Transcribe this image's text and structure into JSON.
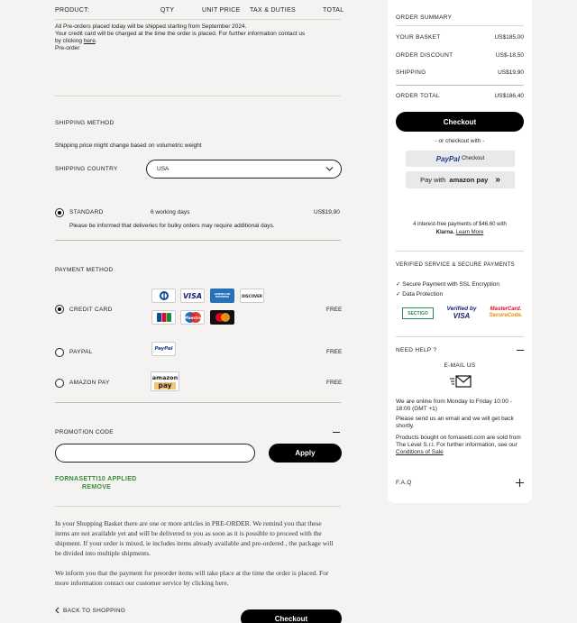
{
  "table_header": {
    "product": "PRODUCT:",
    "qty": "QTY",
    "unit_price": "UNIT PRICE",
    "tax": "TAX & DUTIES",
    "total": "TOTAL"
  },
  "preorder": {
    "line1": "All Pre-orders placed today will be shipped starting from September 2024.",
    "line2": "Your credit card will be charged at the time the order is placed. For further information contact us",
    "line3_prefix": "by clicking ",
    "line3_link": "here",
    "line3_suffix": ".",
    "label": "Pre-order"
  },
  "shipping": {
    "title": "SHIPPING METHOD",
    "note": "Shipping price might change based on volumetric weight",
    "country_label": "SHIPPING COUNTRY",
    "country_value": "USA",
    "option_label": "STANDARD",
    "option_days": "6 working days",
    "option_price": "US$19,90",
    "bulky_note": "Please be informed that deliveries for bulky orders may require additional days."
  },
  "payment": {
    "title": "PAYMENT METHOD",
    "methods": [
      {
        "label": "CREDIT CARD",
        "fee": "FREE"
      },
      {
        "label": "PAYPAL",
        "fee": "FREE"
      },
      {
        "label": "AMAZON PAY",
        "fee": "FREE"
      }
    ],
    "cards": [
      "VISA",
      "AMERICAN EXPRESS",
      "DISCOVER",
      "JCB",
      "Maestro"
    ],
    "paypal_logo": "PayPal",
    "amazon_logo_1": "amazon",
    "amazon_logo_2": "pay"
  },
  "promo": {
    "title": "PROMOTION CODE",
    "input_value": "",
    "apply": "Apply",
    "applied": "FORNASETTI10 APPLIED",
    "remove": "REMOVE"
  },
  "notice": {
    "p1": "In your Shopping Basket there are one or more articles in PRE-ORDER. We remind you that these items are not available yet and will be delivered to you as soon as it is possible to proceed with the shipment. If your order is mixed, ie includes items already available and pre-ordered , the package will be divided into multiple shipments.",
    "p2": "We inform you that the payment for preorder items will take place at the time the order is placed. For more information contact our customer service by clicking here."
  },
  "footer": {
    "back": "BACK TO SHOPPING",
    "checkout": "Checkout"
  },
  "summary": {
    "title": "ORDER SUMMARY",
    "rows": [
      {
        "label": "YOUR BASKET",
        "value": "US$185,00"
      },
      {
        "label": "ORDER DISCOUNT",
        "value": "US$-18,50"
      },
      {
        "label": "SHIPPING",
        "value": "US$19,90"
      }
    ],
    "total_label": "ORDER TOTAL",
    "total_value": "US$186,40",
    "checkout": "Checkout",
    "or_checkout": "- or checkout with -",
    "paypal_btn_1": "PayPal",
    "paypal_btn_2": "Checkout",
    "amazon_btn_1": "Pay with",
    "amazon_btn_2": "amazon pay",
    "klarna_line1": "4 interest-free payments of $46.60 with",
    "klarna_brand": "Klarna.",
    "klarna_link": "Learn More"
  },
  "verified": {
    "title": "VERIFIED SERVICE & SECURE PAYMENTS",
    "items": [
      "✓ Secure Payment with SSL Encryption",
      "✓ Data Protection"
    ],
    "badge1": "SECTIGO",
    "badge2a": "Verified by",
    "badge2b": "VISA",
    "badge3a": "MasterCard.",
    "badge3b": "SecureCode."
  },
  "help": {
    "title": "NEED HELP ?",
    "email_label": "E-MAIL US",
    "hours": "We are online from Monday to Friday 10:00 - 18:00 (GMT +1)",
    "send": "Please send us an email and we will get back shortly.",
    "legal_prefix": "Products bought on fornasetti.com are sold from The Level S.r.l. For further information, see our ",
    "legal_link": "Conditions of Sale",
    "faq": "F.A.Q"
  }
}
